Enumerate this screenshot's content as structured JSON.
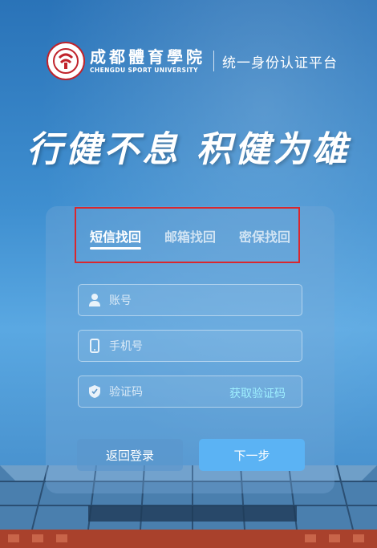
{
  "header": {
    "school_name_cn": "成都體育學院",
    "school_name_en": "CHENGDU SPORT UNIVERSITY",
    "platform_title": "统一身份认证平台"
  },
  "slogan": "行健不息  积健为雄",
  "tabs": [
    {
      "label": "短信找回",
      "active": true
    },
    {
      "label": "邮箱找回",
      "active": false
    },
    {
      "label": "密保找回",
      "active": false
    }
  ],
  "form": {
    "account_placeholder": "账号",
    "phone_placeholder": "手机号",
    "code_placeholder": "验证码",
    "get_code_label": "获取验证码"
  },
  "buttons": {
    "back_label": "返回登录",
    "next_label": "下一步"
  },
  "icons": [
    "user-icon",
    "phone-icon",
    "shield-icon"
  ],
  "colors": {
    "accent": "#5bb3f4",
    "link": "#9ff0ff",
    "highlight_border": "#d9272e"
  }
}
